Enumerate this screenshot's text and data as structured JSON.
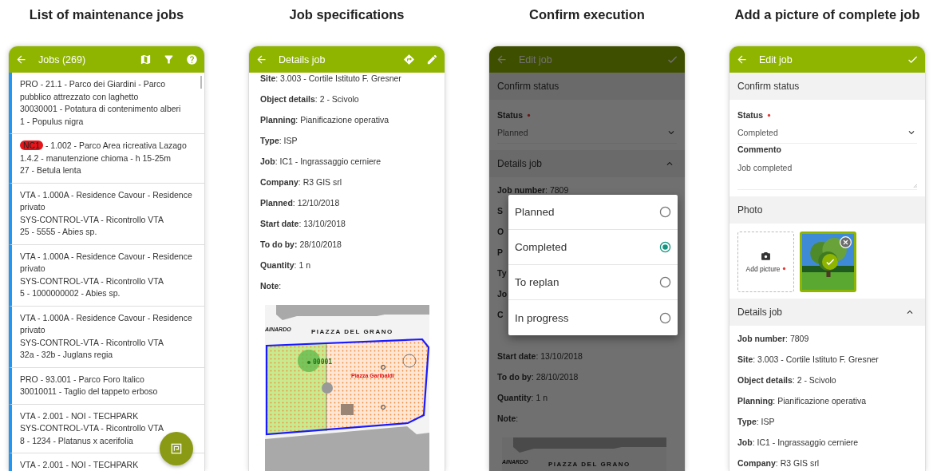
{
  "panels": [
    {
      "caption": "List of maintenance jobs",
      "screen": {
        "kind": "list",
        "title": "Jobs (269)",
        "jobs": [
          {
            "lines": [
              "PRO - 21.1 - Parco dei Giardini - Parco pubblico attrezzato con laghetto",
              "30030001 - Potatura di contenimento alberi",
              "1 - Populus nigra"
            ]
          },
          {
            "tag": "NC1",
            "lines": [
              "- 1.002 - Parco Area ricreativa Lazago",
              "1.4.2 - manutenzione chioma - h 15-25m",
              "27 - Betula lenta"
            ]
          },
          {
            "lines": [
              "VTA - 1.000A - Residence Cavour - Residence privato",
              "SYS-CONTROL-VTA - Ricontrollo VTA",
              "25 - 5555 - Abies sp."
            ]
          },
          {
            "lines": [
              "VTA - 1.000A - Residence Cavour - Residence privato",
              "SYS-CONTROL-VTA - Ricontrollo VTA",
              "5 - 1000000002 - Abies sp."
            ]
          },
          {
            "lines": [
              "VTA - 1.000A - Residence Cavour - Residence privato",
              "SYS-CONTROL-VTA - Ricontrollo VTA",
              "32a - 32b - Juglans regia"
            ]
          },
          {
            "lines": [
              "PRO - 93.001 - Parco Foro Italico",
              "30010011 - Taglio del tappeto erboso"
            ]
          },
          {
            "lines": [
              "VTA - 2.001 - NOI - TECHPARK",
              "SYS-CONTROL-VTA - Ricontrollo VTA",
              "8 - 1234 - Platanus x acerifolia"
            ]
          },
          {
            "lines": [
              "VTA - 2.001 - NOI - TECHPARK"
            ]
          }
        ]
      }
    },
    {
      "caption": "Job specifications",
      "screen": {
        "kind": "details",
        "title": "Details job",
        "rows": [
          "**Site**: 3.003 - Cortile Istituto F. Gresner",
          "**Object details**: 2 - Scivolo",
          "**Planning**: Pianificazione operativa",
          "**Type**: ISP",
          "**Job**: IC1 - Ingrassaggio cerniere",
          "**Company**: R3 GIS srl",
          "**Planned**: 12/10/2018",
          "**Start date**: 13/10/2018",
          "**To do by:** 28/10/2018",
          "**Quantity**: 1 n",
          "**Note**:"
        ],
        "map": {
          "street_labels": [
            "AINARDO",
            "PIAZZA DEL GRANO"
          ],
          "feature_label": "00001",
          "area_label": "Piazza Garibaldi"
        }
      }
    },
    {
      "caption": "Confirm execution",
      "screen": {
        "kind": "edit",
        "title": "Edit job",
        "sections": [
          {
            "kind": "status",
            "title": "Confirm status",
            "fields": [
              {
                "kind": "select",
                "label": "Status",
                "required": true,
                "value": "Planned"
              }
            ]
          },
          {
            "kind": "details",
            "title": "Details job",
            "expanded": true,
            "rows": [
              "**Job number**: 7809",
              "**S**",
              "**O**",
              "**P**",
              "**Ty**",
              "**Jo**",
              "**C**"
            ],
            "rows_below_dialog": [
              "**Start date**: 13/10/2018",
              "**To do by**: 28/10/2018",
              "**Quantity**: 1 n",
              "**Note**:"
            ],
            "map": {
              "street_labels": [
                "AINARDO",
                "PIAZZA DEL GRANO"
              ]
            }
          }
        ],
        "dialog": {
          "options": [
            {
              "label": "Planned",
              "selected": false
            },
            {
              "label": "Completed",
              "selected": true
            },
            {
              "label": "To replan",
              "selected": false
            },
            {
              "label": "In progress",
              "selected": false
            }
          ]
        }
      }
    },
    {
      "caption": "Add a picture of complete job",
      "screen": {
        "kind": "edit",
        "title": "Edit job",
        "sections": [
          {
            "kind": "status",
            "title": "Confirm status",
            "fields": [
              {
                "kind": "select",
                "label": "Status",
                "required": true,
                "value": "Completed"
              },
              {
                "kind": "textarea",
                "label": "Commento",
                "required": false,
                "value": "Job completed"
              }
            ]
          },
          {
            "kind": "photo",
            "title": "Photo",
            "add_label": "Add picture",
            "required": true,
            "photos": [
              {
                "selected": true
              }
            ]
          },
          {
            "kind": "details",
            "title": "Details job",
            "expanded": true,
            "rows": [
              "**Job number**: 7809",
              "**Site**: 3.003 - Cortile Istituto F. Gresner",
              "**Object details**: 2 - Scivolo",
              "**Planning**: Pianificazione operativa",
              "**Type**: ISP",
              "**Job**: IC1 - Ingrassaggio cerniere",
              "**Company**: R3 GIS srl"
            ]
          }
        ]
      }
    }
  ]
}
